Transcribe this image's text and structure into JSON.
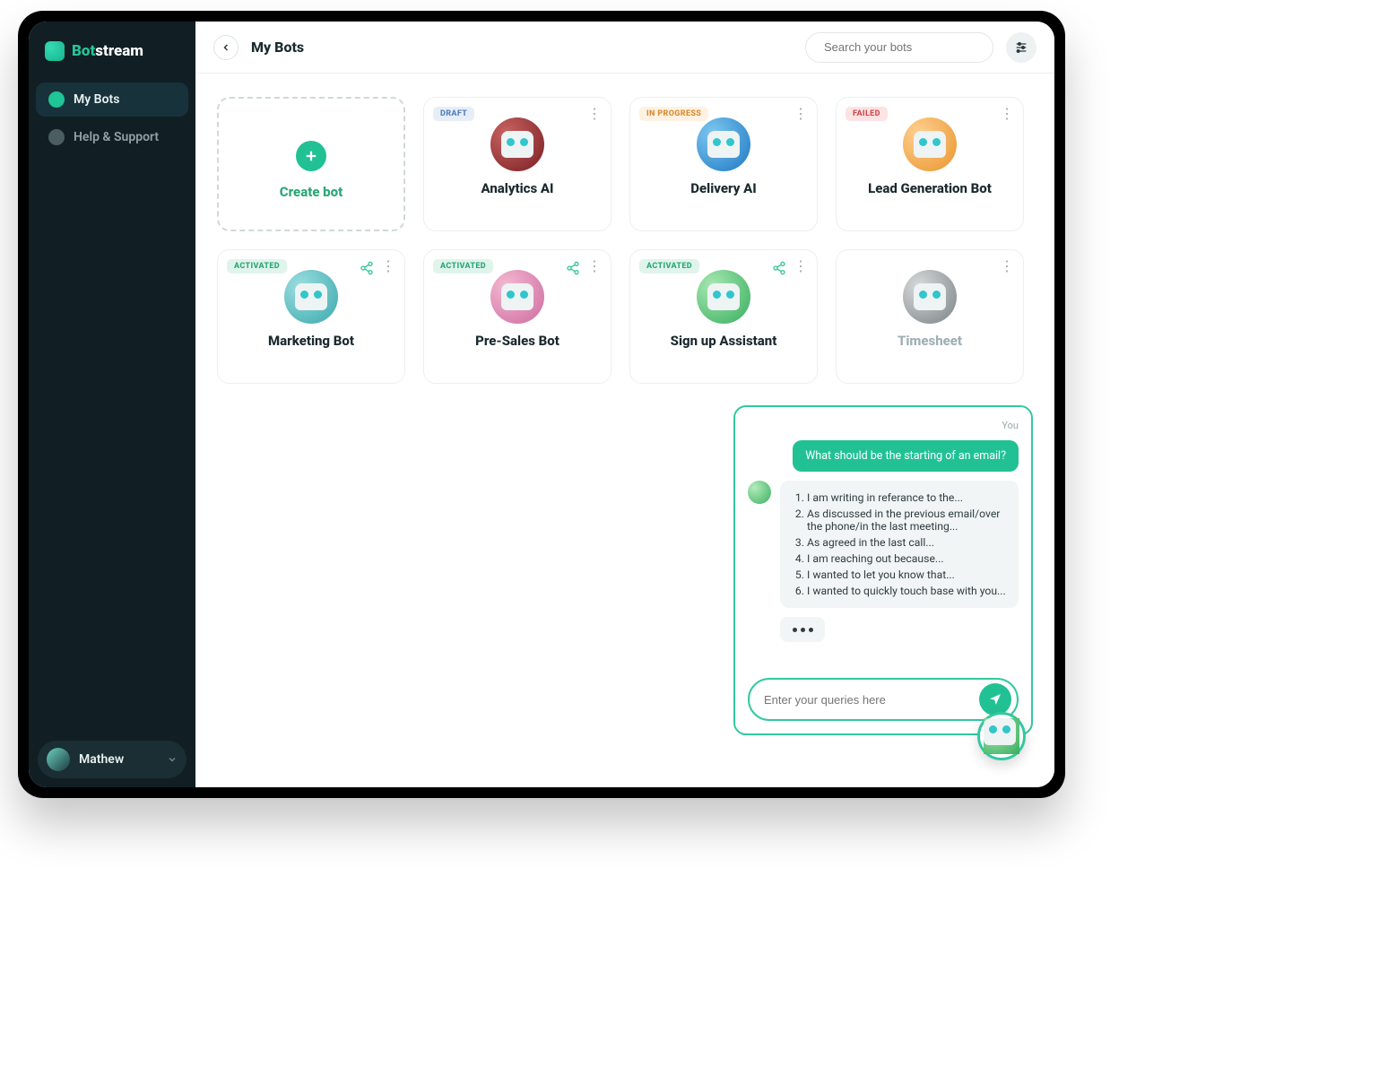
{
  "brand": {
    "name_bot": "Bot",
    "name_stream": "stream"
  },
  "sidebar": {
    "items": [
      {
        "label": "My Bots"
      },
      {
        "label": "Help & Support"
      }
    ],
    "user": {
      "name": "Mathew"
    }
  },
  "header": {
    "title": "My Bots",
    "search_placeholder": "Search your bots"
  },
  "create_label": "Create bot",
  "status_labels": {
    "draft": "DRAFT",
    "inprogress": "IN PROGRESS",
    "failed": "FAILED",
    "activated": "ACTIVATED"
  },
  "bots": [
    {
      "name": "Analytics AI"
    },
    {
      "name": "Delivery AI"
    },
    {
      "name": "Lead Generation Bot"
    },
    {
      "name": "Marketing Bot"
    },
    {
      "name": "Pre-Sales Bot"
    },
    {
      "name": "Sign up Assistant"
    },
    {
      "name": "Timesheet"
    }
  ],
  "chat": {
    "you_label": "You",
    "user_message": "What should be the starting of an email?",
    "bot_reply": [
      "I am writing in referance to the...",
      "As discussed in the previous email/over the phone/in the last meeting...",
      "As agreed in the last call...",
      "I am reaching out because...",
      "I wanted to let you know that...",
      "I wanted to quickly touch base with you..."
    ],
    "input_placeholder": "Enter your queries here"
  }
}
